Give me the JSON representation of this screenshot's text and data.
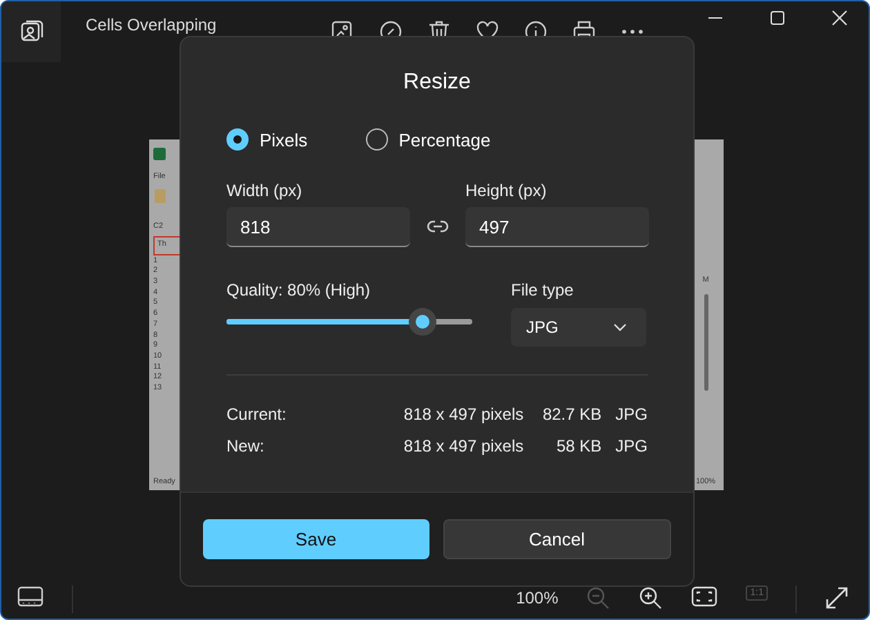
{
  "window": {
    "title": "Cells Overlapping"
  },
  "toolbar": [
    {
      "kind": "edit"
    },
    {
      "kind": "draw"
    },
    {
      "kind": "delete"
    },
    {
      "kind": "favorite"
    },
    {
      "kind": "info"
    },
    {
      "kind": "print"
    },
    {
      "kind": "more"
    }
  ],
  "background_screenshot": {
    "left_texts": [
      "File",
      "C2",
      "Th"
    ],
    "row_numbers": [
      "1",
      "2",
      "3",
      "4",
      "5",
      "6",
      "7",
      "8",
      "9",
      "10",
      "11",
      "12",
      "13"
    ],
    "status": "Ready",
    "column": "M",
    "zoom": "100%"
  },
  "dialog": {
    "title": "Resize",
    "modes": [
      {
        "label": "Pixels",
        "selected": true
      },
      {
        "label": "Percentage",
        "selected": false
      }
    ],
    "width": {
      "label": "Width  (px)",
      "value": "818"
    },
    "height": {
      "label": "Height  (px)",
      "value": "497"
    },
    "quality": {
      "label": "Quality: 80% (High)",
      "level": 0.8
    },
    "file_type": {
      "label": "File type",
      "value": "JPG"
    },
    "info": [
      {
        "label": "Current:",
        "dimensions": "818 x 497 pixels",
        "size": "82.7 KB",
        "format": "JPG"
      },
      {
        "label": "New:",
        "dimensions": "818 x 497 pixels",
        "size": "58 KB",
        "format": "JPG"
      }
    ],
    "buttons": [
      {
        "label": "Save",
        "kind": "primary"
      },
      {
        "label": "Cancel",
        "kind": "secondary"
      }
    ]
  },
  "bottom_bar": {
    "zoom": "100%",
    "zoom_out_disabled": true,
    "actual_size": "1:1",
    "actual_size_disabled": true
  }
}
